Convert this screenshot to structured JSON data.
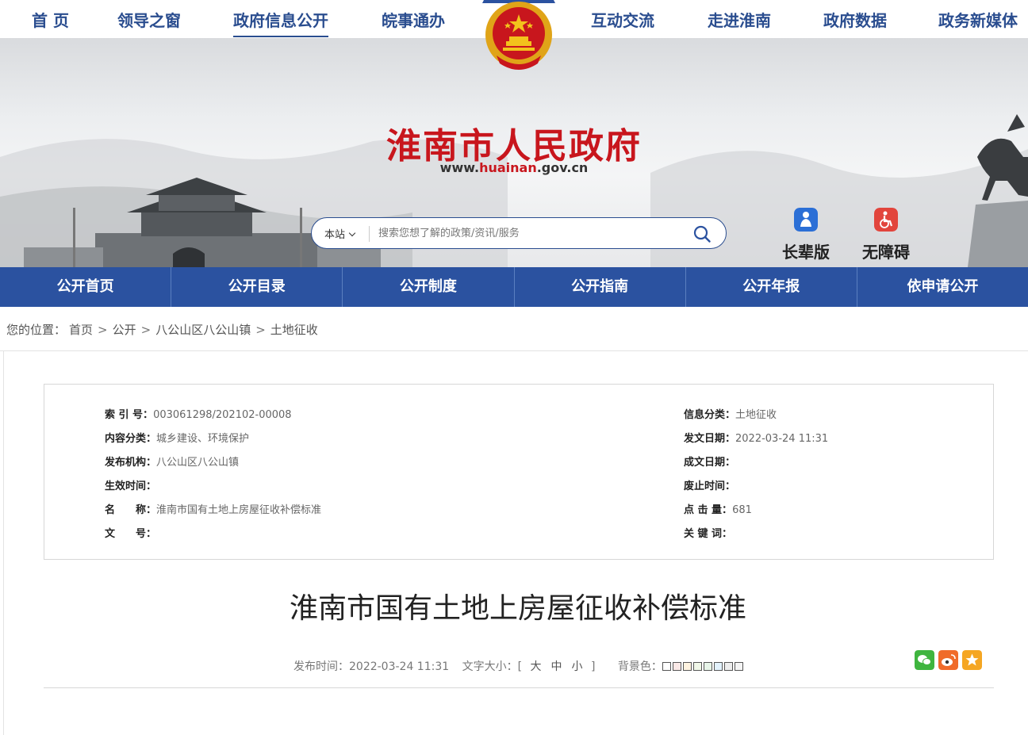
{
  "topnav": {
    "items": [
      {
        "label": "首 页"
      },
      {
        "label": "领导之窗"
      },
      {
        "label": "政府信息公开"
      },
      {
        "label": "皖事通办"
      },
      {
        "label": "互动交流"
      },
      {
        "label": "走进淮南"
      },
      {
        "label": "政府数据"
      },
      {
        "label": "政务新媒体"
      }
    ]
  },
  "header": {
    "title": "淮南市人民政府",
    "url_prefix": "www.",
    "url_highlight": "huainan",
    "url_suffix": ".gov.cn"
  },
  "search": {
    "scope": "本站",
    "placeholder": "搜索您想了解的政策/资讯/服务"
  },
  "tools": {
    "elder": "长辈版",
    "accessible": "无障碍"
  },
  "bluenav": {
    "items": [
      "公开首页",
      "公开目录",
      "公开制度",
      "公开指南",
      "公开年报",
      "依申请公开"
    ]
  },
  "breadcrumb": {
    "prefix": "您的位置：",
    "items": [
      "首页",
      "公开",
      "八公山区八公山镇",
      "土地征收"
    ],
    "sep": ">"
  },
  "meta": {
    "index_no_label": "索 引 号：",
    "index_no": "003061298/202102-00008",
    "category_label": "内容分类：",
    "category": "城乡建设、环境保护",
    "publisher_label": "发布机构：",
    "publisher": "八公山区八公山镇",
    "effective_label": "生效时间：",
    "effective": "",
    "name_label": "名　　称：",
    "name": "淮南市国有土地上房屋征收补偿标准",
    "doc_no_label": "文　　号：",
    "doc_no": "",
    "info_class_label": "信息分类：",
    "info_class": "土地征收",
    "issue_date_label": "发文日期：",
    "issue_date": "2022-03-24 11:31",
    "written_date_label": "成文日期：",
    "written_date": "",
    "abolish_label": "废止时间：",
    "abolish": "",
    "clicks_label": "点 击 量：",
    "clicks": "681",
    "keywords_label": "关 键 词：",
    "keywords": ""
  },
  "article": {
    "title": "淮南市国有土地上房屋征收补偿标准",
    "publish_label": "发布时间：",
    "publish_time": "2022-03-24 11:31",
    "fontsize_label": "文字大小：[",
    "fs_large": "大",
    "fs_medium": "中",
    "fs_small": "小",
    "fontsize_end": "]",
    "bg_label": "背景色：",
    "bg_colors": [
      "#ffffff",
      "#fbe9e7",
      "#fff3e0",
      "#f1f8e9",
      "#e8f5e9",
      "#e3f2fd",
      "#eeeeee",
      "#f5f5f5"
    ]
  },
  "share": {
    "wechat_color": "#3fb53f",
    "weibo_color": "#f06b2a",
    "favorite_color": "#f5a623"
  },
  "colors": {
    "primary_blue": "#2b52a0",
    "title_red": "#c8161d"
  }
}
